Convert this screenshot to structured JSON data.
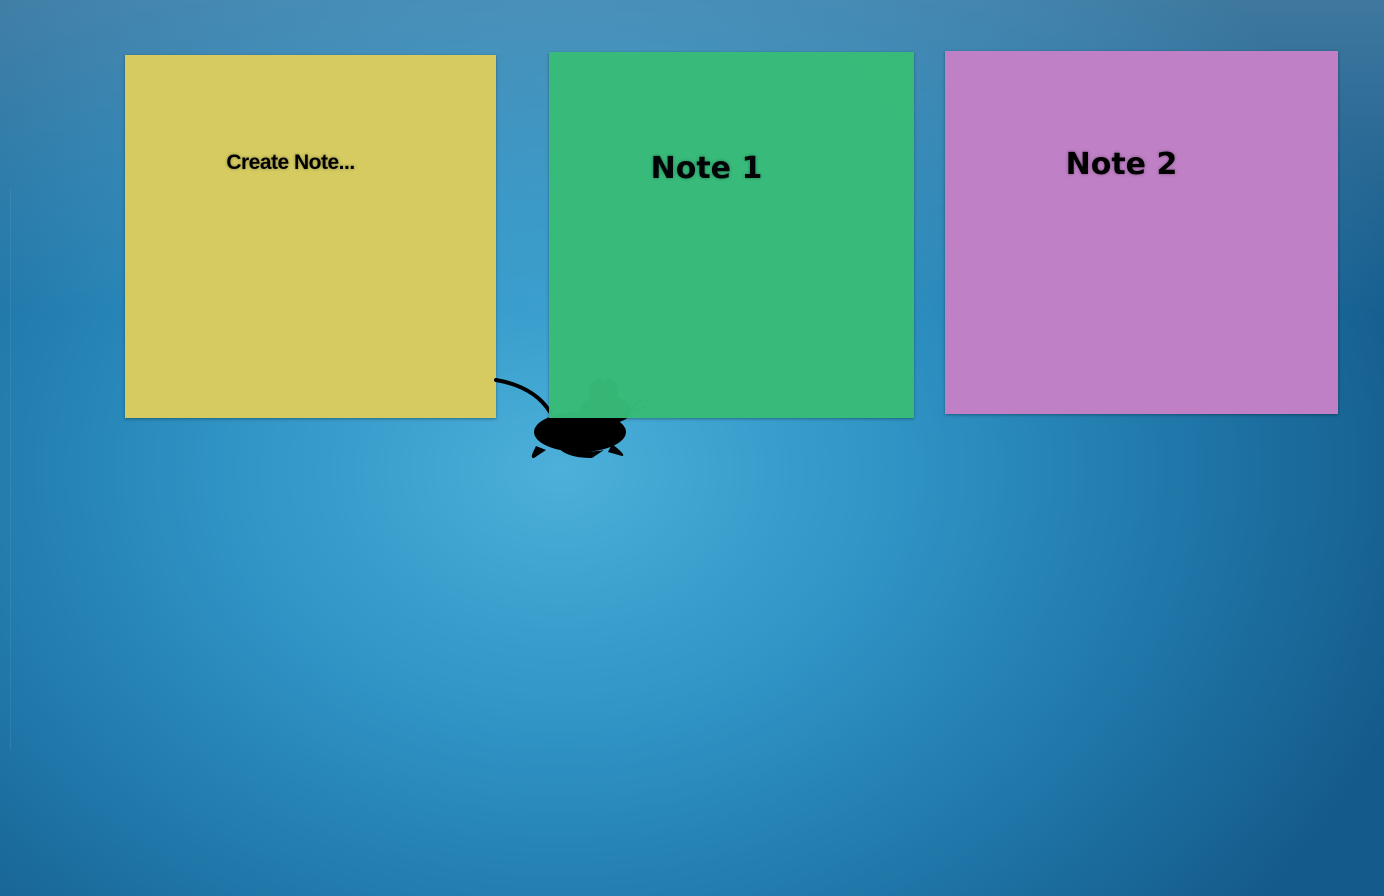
{
  "desktop": {
    "background_colors": [
      "#4cb0da",
      "#2f93c4",
      "#1f76a8",
      "#145a8a"
    ]
  },
  "notes": [
    {
      "title": "Create Note...",
      "color": "#d5cb61"
    },
    {
      "title": "Note 1",
      "color": "#38bc78"
    },
    {
      "title": "Note 2",
      "color": "#bf80c5"
    }
  ],
  "mascot": {
    "icon": "mouse-icon",
    "color": "#000000"
  }
}
